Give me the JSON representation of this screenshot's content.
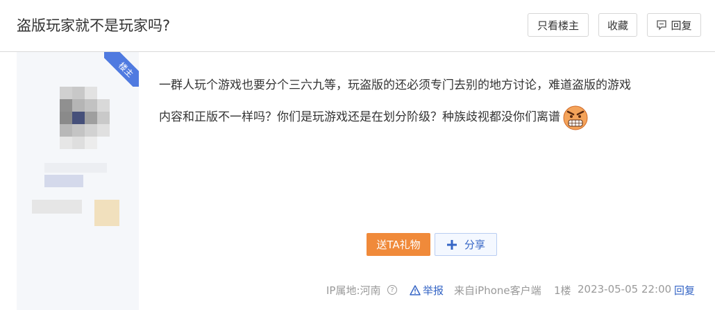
{
  "header": {
    "title": "盗版玩家就不是玩家吗?",
    "buttons": {
      "only_op": "只看楼主",
      "favorite": "收藏",
      "reply": "回复"
    }
  },
  "post": {
    "op_badge": "楼主",
    "content_line1": "一群人玩个游戏也要分个三六九等，玩盗版的还必须专门去别的地方讨论，难道盗版的游戏",
    "content_line2": "内容和正版不一样吗？你们是玩游戏还是在划分阶级？种族歧视都没你们离谱",
    "emoji": "angry-face-icon",
    "gift_label": "送TA礼物",
    "share_label": "分享",
    "tail": {
      "ip_location": "IP属地:河南",
      "report": "举报",
      "client": "来自iPhone客户端",
      "floor": "1楼",
      "time": "2023-05-05 22:00",
      "reply": "回复"
    }
  },
  "colors": {
    "accent_blue": "#3565c5",
    "gift_orange": "#f08a3a",
    "badge_blue": "#4f7ae0"
  }
}
